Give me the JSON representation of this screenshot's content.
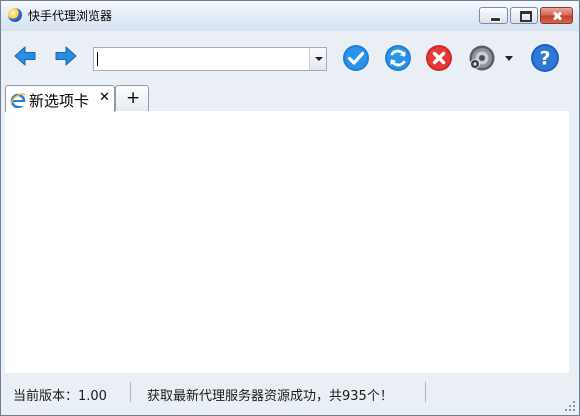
{
  "window": {
    "title": "快手代理浏览器",
    "icon": "app-globe-icon",
    "controls": [
      "minimize-icon",
      "maximize-icon",
      "close-icon"
    ]
  },
  "toolbar": {
    "back_icon": "arrow-left-icon",
    "forward_icon": "arrow-right-icon",
    "address": {
      "value": "",
      "placeholder": ""
    },
    "go_icon": "checkmark-icon",
    "refresh_icon": "refresh-icon",
    "stop_icon": "stop-icon",
    "proxy_icon": "speaker-gear-icon",
    "help_icon": "help-icon",
    "help_glyph": "?",
    "colors": {
      "accent_blue": "#1f7fd8",
      "stop_red": "#d42a2a"
    }
  },
  "tabs": [
    {
      "title": "新选项卡",
      "close": "✕",
      "icon": "ie-icon",
      "active": true
    }
  ],
  "new_tab_label": "+",
  "status": {
    "version": "当前版本：1.00",
    "message": "获取最新代理服务器资源成功，共935个！"
  }
}
